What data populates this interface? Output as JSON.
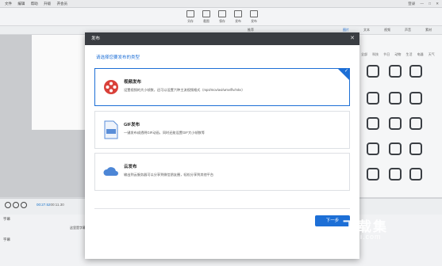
{
  "menu": {
    "items": [
      "文件",
      "编辑",
      "帮助",
      "升级",
      "开会员"
    ]
  },
  "window": {
    "controls": [
      "登录",
      "—",
      "□",
      "✕"
    ]
  },
  "toolbar": {
    "items": [
      "另存",
      "截图",
      "保存",
      "发布",
      "发布"
    ]
  },
  "subtoolbar": {
    "items": [
      "推荐",
      "图片",
      "文本",
      "视频",
      "声音",
      "素材"
    ]
  },
  "rightpanel": {
    "categories": [
      "全部",
      "科技",
      "节日",
      "动物",
      "生活",
      "电器",
      "天气"
    ]
  },
  "timeline": {
    "current": "00:27.52",
    "total": "00:11.30",
    "track1": "字幕",
    "track2": "字幕",
    "clip_label": "这里是字幕"
  },
  "dialog": {
    "title": "发布",
    "close": "✕",
    "prompt": "请选择您要发布的类型",
    "options": [
      {
        "title": "视频发布",
        "desc": "设置视频的大小帧数，还可以设置六种主流视频格式（mp4/mov/avi/wmv/flv/mkv）",
        "selected": true
      },
      {
        "title": "GIF发布",
        "desc": "一键发布成透明GIF动画，同时还能设置GIF大小帧数等",
        "selected": false
      },
      {
        "title": "云发布",
        "desc": "输出到云服务器可以分享到微信朋友圈，轻松分享到其他平台",
        "selected": false
      }
    ],
    "next": "下一步"
  },
  "watermark": {
    "text": "下载集",
    "url": "xzji.com"
  },
  "colors": {
    "accent": "#1d6fd6",
    "dialog_header": "#3a3d42"
  }
}
